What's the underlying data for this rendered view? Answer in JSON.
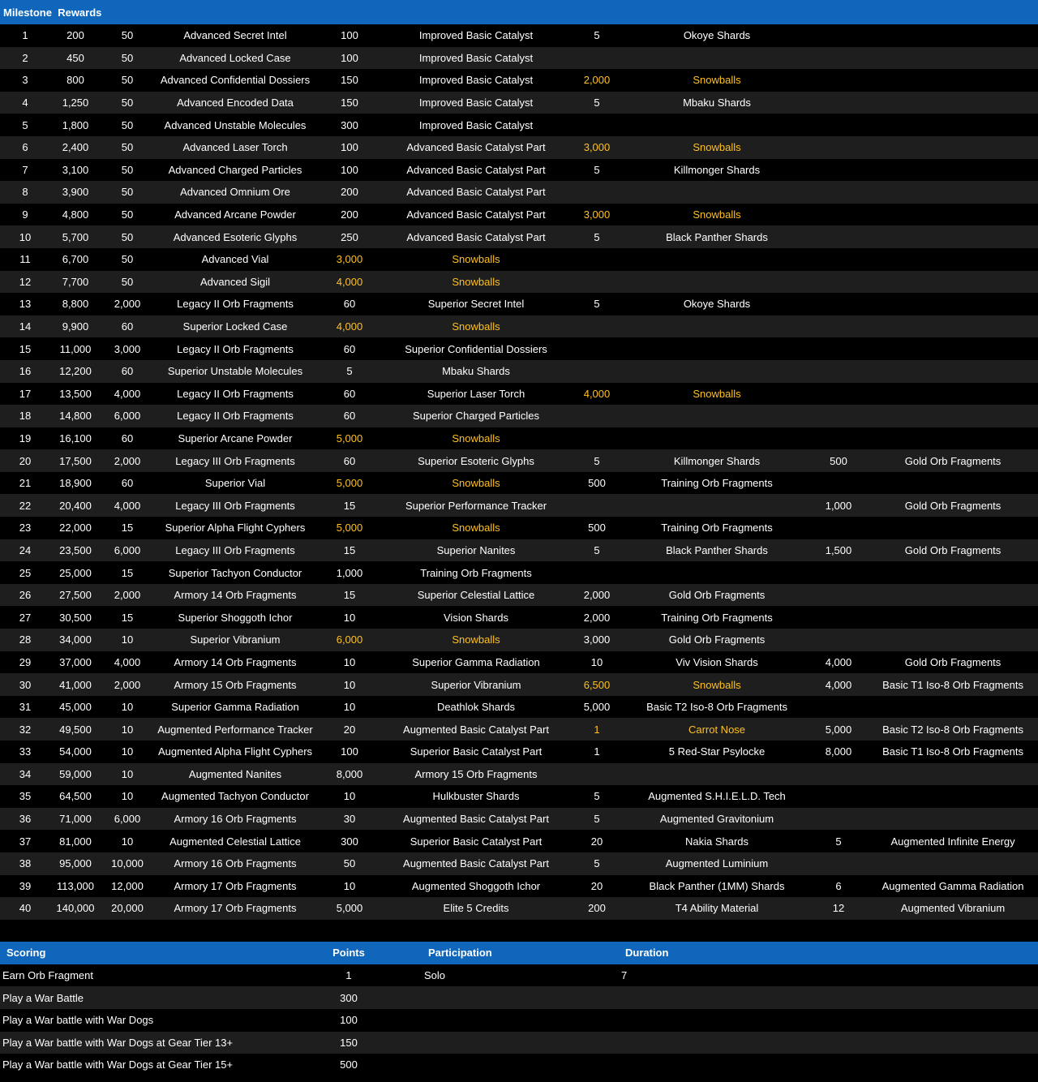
{
  "rewards_table": {
    "headers": [
      "Milestone",
      "Rewards"
    ],
    "rows": [
      [
        "1",
        "200",
        "50",
        "Advanced Secret Intel",
        "100",
        "Improved Basic Catalyst",
        "5",
        "Okoye Shards",
        "",
        ""
      ],
      [
        "2",
        "450",
        "50",
        "Advanced Locked Case",
        "100",
        "Improved Basic Catalyst",
        "",
        "",
        "",
        ""
      ],
      [
        "3",
        "800",
        "50",
        "Advanced Confidential Dossiers",
        "150",
        "Improved Basic Catalyst",
        "2,000",
        "Snowballs",
        "",
        ""
      ],
      [
        "4",
        "1,250",
        "50",
        "Advanced Encoded Data",
        "150",
        "Improved Basic Catalyst",
        "5",
        "Mbaku Shards",
        "",
        ""
      ],
      [
        "5",
        "1,800",
        "50",
        "Advanced Unstable Molecules",
        "300",
        "Improved Basic Catalyst",
        "",
        "",
        "",
        ""
      ],
      [
        "6",
        "2,400",
        "50",
        "Advanced Laser Torch",
        "100",
        "Advanced Basic Catalyst Part",
        "3,000",
        "Snowballs",
        "",
        ""
      ],
      [
        "7",
        "3,100",
        "50",
        "Advanced Charged Particles",
        "100",
        "Advanced Basic Catalyst Part",
        "5",
        "Killmonger Shards",
        "",
        ""
      ],
      [
        "8",
        "3,900",
        "50",
        "Advanced Omnium Ore",
        "200",
        "Advanced Basic Catalyst Part",
        "",
        "",
        "",
        ""
      ],
      [
        "9",
        "4,800",
        "50",
        "Advanced Arcane Powder",
        "200",
        "Advanced Basic Catalyst Part",
        "3,000",
        "Snowballs",
        "",
        ""
      ],
      [
        "10",
        "5,700",
        "50",
        "Advanced Esoteric Glyphs",
        "250",
        "Advanced Basic Catalyst Part",
        "5",
        "Black Panther Shards",
        "",
        ""
      ],
      [
        "11",
        "6,700",
        "50",
        "Advanced Vial",
        "3,000",
        "Snowballs",
        "",
        "",
        "",
        ""
      ],
      [
        "12",
        "7,700",
        "50",
        "Advanced Sigil",
        "4,000",
        "Snowballs",
        "",
        "",
        "",
        ""
      ],
      [
        "13",
        "8,800",
        "2,000",
        "Legacy II Orb Fragments",
        "60",
        "Superior Secret Intel",
        "5",
        "Okoye Shards",
        "",
        ""
      ],
      [
        "14",
        "9,900",
        "60",
        "Superior Locked Case",
        "4,000",
        "Snowballs",
        "",
        "",
        "",
        ""
      ],
      [
        "15",
        "11,000",
        "3,000",
        "Legacy II Orb Fragments",
        "60",
        "Superior Confidential Dossiers",
        "",
        "",
        "",
        ""
      ],
      [
        "16",
        "12,200",
        "60",
        "Superior Unstable Molecules",
        "5",
        "Mbaku Shards",
        "",
        "",
        "",
        ""
      ],
      [
        "17",
        "13,500",
        "4,000",
        "Legacy II Orb Fragments",
        "60",
        "Superior Laser Torch",
        "4,000",
        "Snowballs",
        "",
        ""
      ],
      [
        "18",
        "14,800",
        "6,000",
        "Legacy II Orb Fragments",
        "60",
        "Superior Charged Particles",
        "",
        "",
        "",
        ""
      ],
      [
        "19",
        "16,100",
        "60",
        "Superior Arcane Powder",
        "5,000",
        "Snowballs",
        "",
        "",
        "",
        ""
      ],
      [
        "20",
        "17,500",
        "2,000",
        "Legacy III Orb Fragments",
        "60",
        "Superior Esoteric Glyphs",
        "5",
        "Killmonger Shards",
        "500",
        "Gold Orb Fragments"
      ],
      [
        "21",
        "18,900",
        "60",
        "Superior Vial",
        "5,000",
        "Snowballs",
        "500",
        "Training Orb Fragments",
        "",
        ""
      ],
      [
        "22",
        "20,400",
        "4,000",
        "Legacy III Orb Fragments",
        "15",
        "Superior Performance Tracker",
        "",
        "",
        "1,000",
        "Gold Orb Fragments"
      ],
      [
        "23",
        "22,000",
        "15",
        "Superior Alpha Flight Cyphers",
        "5,000",
        "Snowballs",
        "500",
        "Training Orb Fragments",
        "",
        ""
      ],
      [
        "24",
        "23,500",
        "6,000",
        "Legacy III Orb Fragments",
        "15",
        "Superior Nanites",
        "5",
        "Black Panther Shards",
        "1,500",
        "Gold Orb Fragments"
      ],
      [
        "25",
        "25,000",
        "15",
        "Superior Tachyon Conductor",
        "1,000",
        "Training Orb Fragments",
        "",
        "",
        "",
        ""
      ],
      [
        "26",
        "27,500",
        "2,000",
        "Armory 14 Orb Fragments",
        "15",
        "Superior Celestial Lattice",
        "2,000",
        "Gold Orb Fragments",
        "",
        ""
      ],
      [
        "27",
        "30,500",
        "15",
        "Superior Shoggoth Ichor",
        "10",
        "Vision Shards",
        "2,000",
        "Training Orb Fragments",
        "",
        ""
      ],
      [
        "28",
        "34,000",
        "10",
        "Superior Vibranium",
        "6,000",
        "Snowballs",
        "3,000",
        "Gold Orb Fragments",
        "",
        ""
      ],
      [
        "29",
        "37,000",
        "4,000",
        "Armory 14 Orb Fragments",
        "10",
        "Superior Gamma Radiation",
        "10",
        "Viv Vision Shards",
        "4,000",
        "Gold Orb Fragments"
      ],
      [
        "30",
        "41,000",
        "2,000",
        "Armory 15 Orb Fragments",
        "10",
        "Superior Vibranium",
        "6,500",
        "Snowballs",
        "4,000",
        "Basic T1 Iso-8 Orb Fragments"
      ],
      [
        "31",
        "45,000",
        "10",
        "Superior Gamma Radiation",
        "10",
        "Deathlok Shards",
        "5,000",
        "Basic T2 Iso-8 Orb Fragments",
        "",
        ""
      ],
      [
        "32",
        "49,500",
        "10",
        "Augmented Performance Tracker",
        "20",
        "Augmented Basic Catalyst Part",
        "1",
        "Carrot Nose",
        "5,000",
        "Basic T2 Iso-8 Orb Fragments"
      ],
      [
        "33",
        "54,000",
        "10",
        "Augmented Alpha Flight Cyphers",
        "100",
        "Superior Basic Catalyst Part",
        "1",
        "5 Red-Star Psylocke",
        "8,000",
        "Basic T1 Iso-8 Orb Fragments"
      ],
      [
        "34",
        "59,000",
        "10",
        "Augmented Nanites",
        "8,000",
        "Armory 15 Orb Fragments",
        "",
        "",
        "",
        ""
      ],
      [
        "35",
        "64,500",
        "10",
        "Augmented Tachyon Conductor",
        "10",
        "Hulkbuster Shards",
        "5",
        "Augmented S.H.I.E.L.D. Tech",
        "",
        ""
      ],
      [
        "36",
        "71,000",
        "6,000",
        "Armory 16 Orb Fragments",
        "30",
        "Augmented Basic Catalyst Part",
        "5",
        "Augmented Gravitonium",
        "",
        ""
      ],
      [
        "37",
        "81,000",
        "10",
        "Augmented Celestial Lattice",
        "300",
        "Superior Basic Catalyst Part",
        "20",
        "Nakia Shards",
        "5",
        "Augmented Infinite Energy"
      ],
      [
        "38",
        "95,000",
        "10,000",
        "Armory 16 Orb Fragments",
        "50",
        "Augmented Basic Catalyst Part",
        "5",
        "Augmented Luminium",
        "",
        ""
      ],
      [
        "39",
        "113,000",
        "12,000",
        "Armory 17 Orb Fragments",
        "10",
        "Augmented Shoggoth Ichor",
        "20",
        "Black Panther (1MM) Shards",
        "6",
        "Augmented Gamma Radiation"
      ],
      [
        "40",
        "140,000",
        "20,000",
        "Armory 17 Orb Fragments",
        "5,000",
        "Elite 5 Credits",
        "200",
        "T4 Ability Material",
        "12",
        "Augmented Vibranium"
      ]
    ]
  },
  "scoring_table": {
    "headers": [
      "Scoring",
      "Points",
      "Participation",
      "Duration"
    ],
    "rows": [
      [
        "Earn Orb Fragment",
        "1",
        "Solo",
        "7"
      ],
      [
        "Play a War Battle",
        "300",
        "",
        ""
      ],
      [
        "Play a War battle with War Dogs",
        "100",
        "",
        ""
      ],
      [
        "Play a War battle with War Dogs at Gear Tier 13+",
        "150",
        "",
        ""
      ],
      [
        "Play a War battle with War Dogs at Gear Tier 15+",
        "500",
        "",
        ""
      ]
    ]
  },
  "colors": {
    "header_bg": "#0f66bb",
    "row_dark": "#000000",
    "row_light": "#1e1e1e",
    "text": "#ffffff",
    "highlight": "#ffc020"
  }
}
